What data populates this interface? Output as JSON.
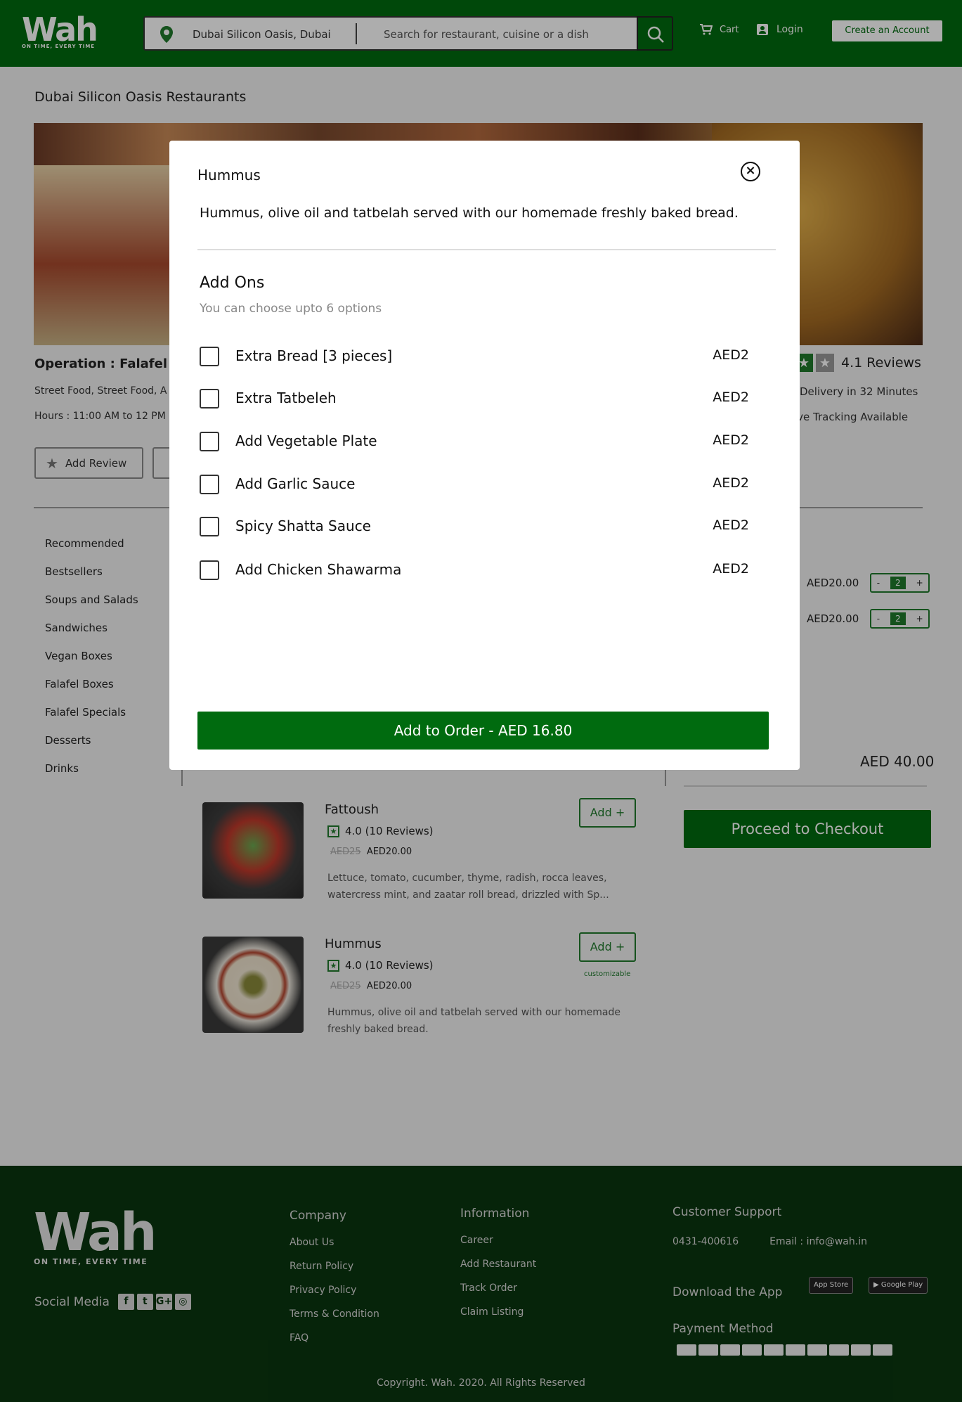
{
  "header": {
    "logo_word": "Wah",
    "logo_tag": "ON TIME, EVERY TIME",
    "location": "Dubai Silicon Oasis, Dubai",
    "search_placeholder": "Search for restaurant, cuisine or a dish",
    "cart_label": "Cart",
    "login_label": "Login",
    "create_account_label": "Create an Account"
  },
  "page": {
    "title": "Dubai Silicon Oasis Restaurants"
  },
  "restaurant": {
    "name": "Operation : Falafel",
    "cuisine": "Street Food, Street Food, A",
    "hours": "Hours : 11:00 AM to 12 PM",
    "add_review_label": "Add Review",
    "reviews": "4.1 Reviews",
    "delivery": "Delivery in 32 Minutes",
    "tracking": "ive Tracking Available"
  },
  "categories": [
    "Recommended",
    "Bestsellers",
    "Soups and Salads",
    "Sandwiches",
    "Vegan Boxes",
    "Falafel Boxes",
    "Falafel Specials",
    "Desserts",
    "Drinks"
  ],
  "dishes": [
    {
      "name": "Fattoush",
      "rating": "4.0 (10 Reviews)",
      "old_price": "AED25",
      "price": "AED20.00",
      "description": "Lettuce, tomato, cucumber, thyme, radish, rocca leaves, watercress mint, and zaatar roll bread, drizzled with Sp...",
      "add_label": "Add +"
    },
    {
      "name": "Hummus",
      "rating": "4.0 (10 Reviews)",
      "old_price": "AED25",
      "price": "AED20.00",
      "description": "Hummus, olive oil and tatbelah served with our homemade freshly baked bread.",
      "add_label": "Add +",
      "customizable": "customizable"
    }
  ],
  "cart": {
    "items": [
      {
        "price": "AED20.00",
        "qty": "2"
      },
      {
        "price": "AED20.00",
        "qty": "2"
      }
    ],
    "total": "AED 40.00",
    "checkout_label": "Proceed to Checkout"
  },
  "modal": {
    "title": "Hummus",
    "description": "Hummus, olive oil and tatbelah served with our homemade freshly baked bread.",
    "addons_title": "Add Ons",
    "addons_subtitle": "You can choose upto 6 options",
    "options": [
      {
        "label": "Extra Bread [3 pieces]",
        "price": "AED2"
      },
      {
        "label": "Extra Tatbeleh",
        "price": "AED2"
      },
      {
        "label": "Add Vegetable Plate",
        "price": "AED2"
      },
      {
        "label": "Add Garlic Sauce",
        "price": "AED2"
      },
      {
        "label": "Spicy Shatta Sauce",
        "price": "AED2"
      },
      {
        "label": "Add Chicken Shawarma",
        "price": "AED2"
      }
    ],
    "order_button": "Add to Order - AED 16.80"
  },
  "footer": {
    "logo_word": "Wah",
    "logo_tag": "ON TIME, EVERY TIME",
    "social_label": "Social Media",
    "company_title": "Company",
    "company_links": [
      "About Us",
      "Return Policy",
      "Privacy Policy",
      "Terms & Condition",
      "FAQ"
    ],
    "information_title": "Information",
    "information_links": [
      "Career",
      "Add Restaurant",
      "Track Order",
      "Claim Listing"
    ],
    "support_title": "Customer Support",
    "phone": "0431-400616",
    "email": "Email    : info@wah.in",
    "download_title": "Download the App",
    "app_store": "App Store",
    "google_play": "Google Play",
    "payment_title": "Payment Method",
    "copyright": "Copyright. Wah. 2020. All Rights Reserved"
  },
  "colors": {
    "brand_green": "#006b0f",
    "footer_bg": "#0a360f",
    "page_bg": "#f2f2f2"
  }
}
